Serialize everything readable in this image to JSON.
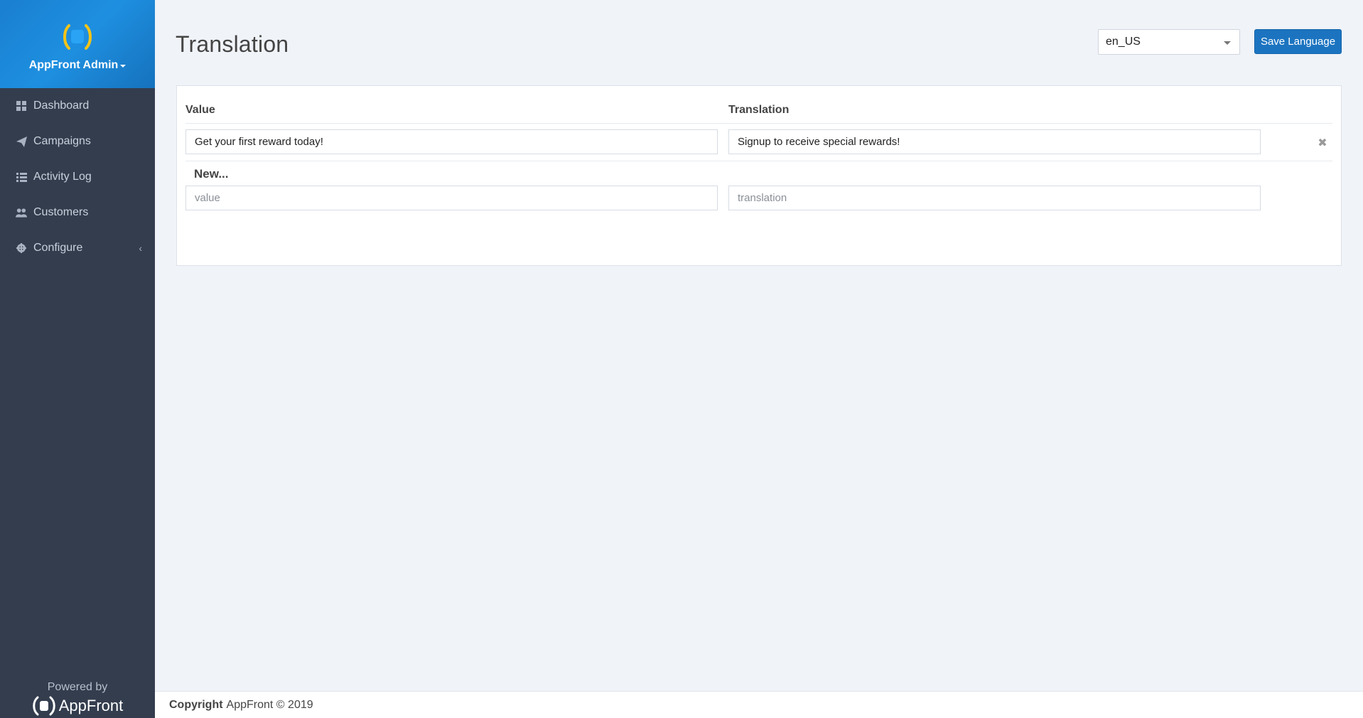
{
  "app": {
    "brand_name": "AppFront Admin"
  },
  "sidebar": {
    "items": [
      {
        "label": "Dashboard",
        "icon": "dashboard-icon"
      },
      {
        "label": "Campaigns",
        "icon": "paper-plane-icon"
      },
      {
        "label": "Activity Log",
        "icon": "list-icon"
      },
      {
        "label": "Customers",
        "icon": "users-icon"
      },
      {
        "label": "Configure",
        "icon": "gear-icon",
        "has_submenu": true
      }
    ],
    "powered_by_label": "Powered by",
    "powered_by_brand": "AppFront"
  },
  "header": {
    "title": "Translation",
    "language": {
      "selected": "en_US"
    },
    "save_label": "Save Language"
  },
  "table": {
    "columns": [
      "Value",
      "Translation"
    ],
    "rows": [
      {
        "value": "Get your first reward today!",
        "translation": "Signup to receive special rewards!"
      }
    ],
    "new_label": "New...",
    "new_row": {
      "value_placeholder": "value",
      "translation_placeholder": "translation"
    }
  },
  "footer": {
    "copyright_label": "Copyright",
    "copyright_text": "AppFront © 2019"
  },
  "colors": {
    "sidebar_bg": "#333d4e",
    "brand_blue": "#1e8fe0",
    "accent_yellow": "#f2c417",
    "button_blue": "#1c74c0"
  }
}
